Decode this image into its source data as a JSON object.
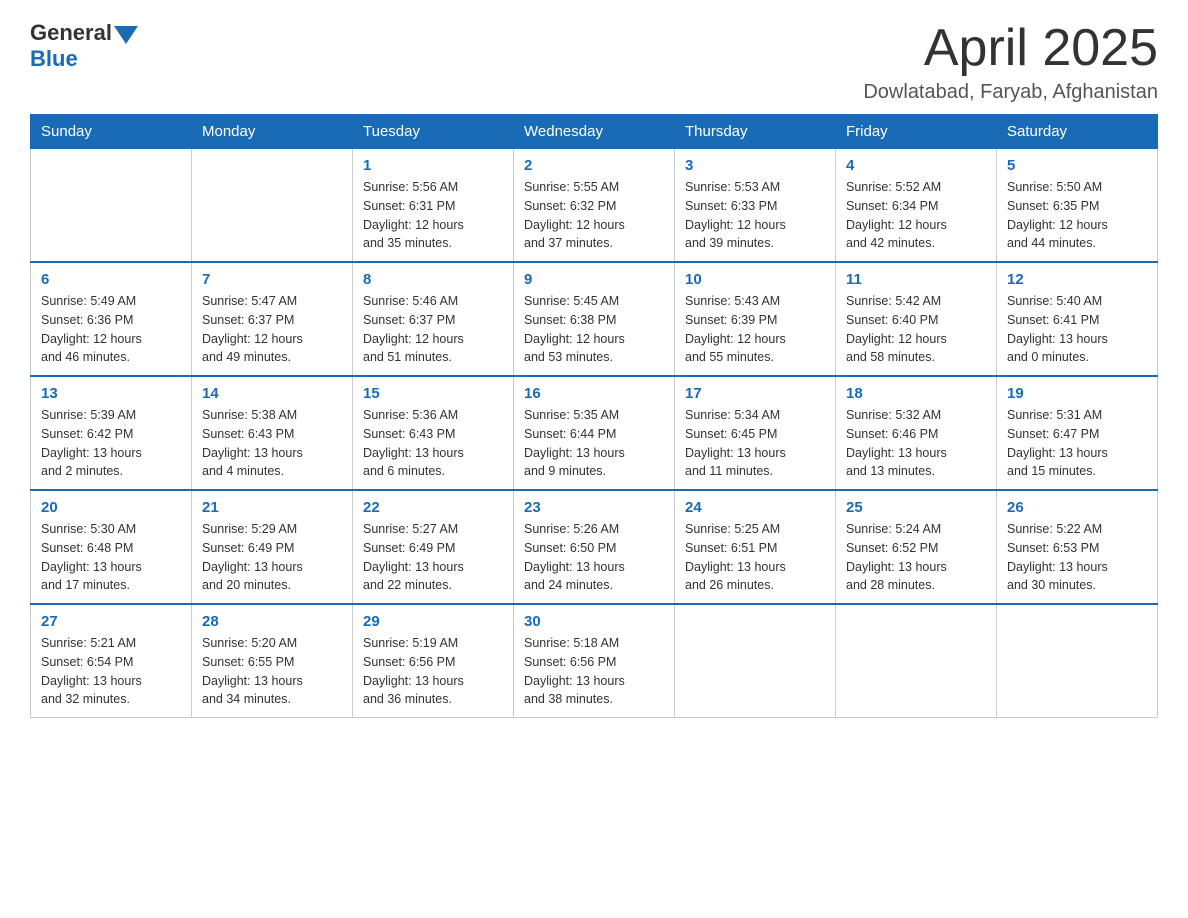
{
  "header": {
    "logo_general": "General",
    "logo_blue": "Blue",
    "month_title": "April 2025",
    "location": "Dowlatabad, Faryab, Afghanistan"
  },
  "days_of_week": [
    "Sunday",
    "Monday",
    "Tuesday",
    "Wednesday",
    "Thursday",
    "Friday",
    "Saturday"
  ],
  "weeks": [
    [
      {
        "day": "",
        "info": ""
      },
      {
        "day": "",
        "info": ""
      },
      {
        "day": "1",
        "info": "Sunrise: 5:56 AM\nSunset: 6:31 PM\nDaylight: 12 hours\nand 35 minutes."
      },
      {
        "day": "2",
        "info": "Sunrise: 5:55 AM\nSunset: 6:32 PM\nDaylight: 12 hours\nand 37 minutes."
      },
      {
        "day": "3",
        "info": "Sunrise: 5:53 AM\nSunset: 6:33 PM\nDaylight: 12 hours\nand 39 minutes."
      },
      {
        "day": "4",
        "info": "Sunrise: 5:52 AM\nSunset: 6:34 PM\nDaylight: 12 hours\nand 42 minutes."
      },
      {
        "day": "5",
        "info": "Sunrise: 5:50 AM\nSunset: 6:35 PM\nDaylight: 12 hours\nand 44 minutes."
      }
    ],
    [
      {
        "day": "6",
        "info": "Sunrise: 5:49 AM\nSunset: 6:36 PM\nDaylight: 12 hours\nand 46 minutes."
      },
      {
        "day": "7",
        "info": "Sunrise: 5:47 AM\nSunset: 6:37 PM\nDaylight: 12 hours\nand 49 minutes."
      },
      {
        "day": "8",
        "info": "Sunrise: 5:46 AM\nSunset: 6:37 PM\nDaylight: 12 hours\nand 51 minutes."
      },
      {
        "day": "9",
        "info": "Sunrise: 5:45 AM\nSunset: 6:38 PM\nDaylight: 12 hours\nand 53 minutes."
      },
      {
        "day": "10",
        "info": "Sunrise: 5:43 AM\nSunset: 6:39 PM\nDaylight: 12 hours\nand 55 minutes."
      },
      {
        "day": "11",
        "info": "Sunrise: 5:42 AM\nSunset: 6:40 PM\nDaylight: 12 hours\nand 58 minutes."
      },
      {
        "day": "12",
        "info": "Sunrise: 5:40 AM\nSunset: 6:41 PM\nDaylight: 13 hours\nand 0 minutes."
      }
    ],
    [
      {
        "day": "13",
        "info": "Sunrise: 5:39 AM\nSunset: 6:42 PM\nDaylight: 13 hours\nand 2 minutes."
      },
      {
        "day": "14",
        "info": "Sunrise: 5:38 AM\nSunset: 6:43 PM\nDaylight: 13 hours\nand 4 minutes."
      },
      {
        "day": "15",
        "info": "Sunrise: 5:36 AM\nSunset: 6:43 PM\nDaylight: 13 hours\nand 6 minutes."
      },
      {
        "day": "16",
        "info": "Sunrise: 5:35 AM\nSunset: 6:44 PM\nDaylight: 13 hours\nand 9 minutes."
      },
      {
        "day": "17",
        "info": "Sunrise: 5:34 AM\nSunset: 6:45 PM\nDaylight: 13 hours\nand 11 minutes."
      },
      {
        "day": "18",
        "info": "Sunrise: 5:32 AM\nSunset: 6:46 PM\nDaylight: 13 hours\nand 13 minutes."
      },
      {
        "day": "19",
        "info": "Sunrise: 5:31 AM\nSunset: 6:47 PM\nDaylight: 13 hours\nand 15 minutes."
      }
    ],
    [
      {
        "day": "20",
        "info": "Sunrise: 5:30 AM\nSunset: 6:48 PM\nDaylight: 13 hours\nand 17 minutes."
      },
      {
        "day": "21",
        "info": "Sunrise: 5:29 AM\nSunset: 6:49 PM\nDaylight: 13 hours\nand 20 minutes."
      },
      {
        "day": "22",
        "info": "Sunrise: 5:27 AM\nSunset: 6:49 PM\nDaylight: 13 hours\nand 22 minutes."
      },
      {
        "day": "23",
        "info": "Sunrise: 5:26 AM\nSunset: 6:50 PM\nDaylight: 13 hours\nand 24 minutes."
      },
      {
        "day": "24",
        "info": "Sunrise: 5:25 AM\nSunset: 6:51 PM\nDaylight: 13 hours\nand 26 minutes."
      },
      {
        "day": "25",
        "info": "Sunrise: 5:24 AM\nSunset: 6:52 PM\nDaylight: 13 hours\nand 28 minutes."
      },
      {
        "day": "26",
        "info": "Sunrise: 5:22 AM\nSunset: 6:53 PM\nDaylight: 13 hours\nand 30 minutes."
      }
    ],
    [
      {
        "day": "27",
        "info": "Sunrise: 5:21 AM\nSunset: 6:54 PM\nDaylight: 13 hours\nand 32 minutes."
      },
      {
        "day": "28",
        "info": "Sunrise: 5:20 AM\nSunset: 6:55 PM\nDaylight: 13 hours\nand 34 minutes."
      },
      {
        "day": "29",
        "info": "Sunrise: 5:19 AM\nSunset: 6:56 PM\nDaylight: 13 hours\nand 36 minutes."
      },
      {
        "day": "30",
        "info": "Sunrise: 5:18 AM\nSunset: 6:56 PM\nDaylight: 13 hours\nand 38 minutes."
      },
      {
        "day": "",
        "info": ""
      },
      {
        "day": "",
        "info": ""
      },
      {
        "day": "",
        "info": ""
      }
    ]
  ]
}
